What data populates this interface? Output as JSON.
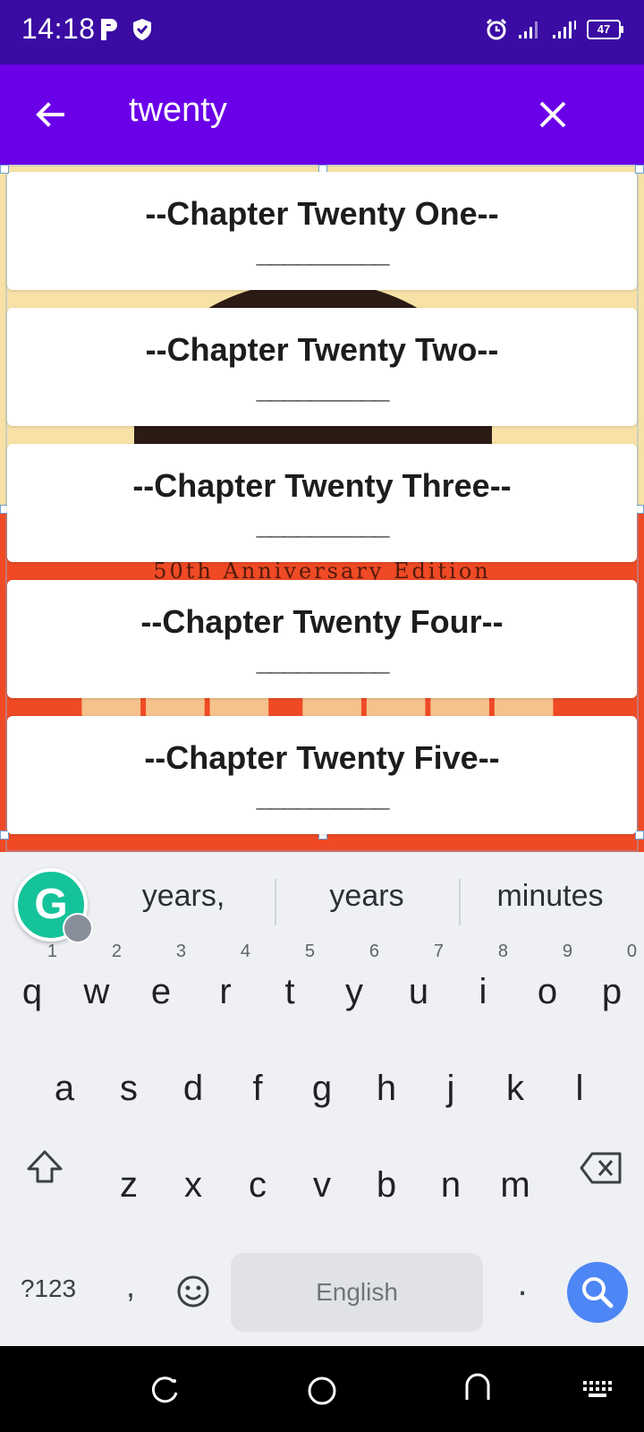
{
  "status_bar": {
    "time": "14:18",
    "battery": "47"
  },
  "app_bar": {
    "search_query": "twenty"
  },
  "results": {
    "cover_text": "50th Anniversary Edition",
    "cards": [
      {
        "title": "--Chapter Twenty One--",
        "rule": "__________"
      },
      {
        "title": "--Chapter Twenty Two--",
        "rule": "__________"
      },
      {
        "title": "--Chapter Twenty Three--",
        "rule": "__________"
      },
      {
        "title": "--Chapter Twenty Four--",
        "rule": "__________"
      },
      {
        "title": "--Chapter Twenty Five--",
        "rule": "__________"
      }
    ]
  },
  "keyboard": {
    "suggestions": [
      "years,",
      "years",
      "minutes"
    ],
    "row1": [
      "q",
      "w",
      "e",
      "r",
      "t",
      "y",
      "u",
      "i",
      "o",
      "p"
    ],
    "row1_numbers": [
      "1",
      "2",
      "3",
      "4",
      "5",
      "6",
      "7",
      "8",
      "9",
      "0"
    ],
    "row2": [
      "a",
      "s",
      "d",
      "f",
      "g",
      "h",
      "j",
      "k",
      "l"
    ],
    "row3": [
      "z",
      "x",
      "c",
      "v",
      "b",
      "n",
      "m"
    ],
    "symbols_label": "?123",
    "comma": ",",
    "period": ".",
    "space_label": "English"
  },
  "icons": {
    "back": "arrow-left-icon",
    "close": "close-icon",
    "search": "search-icon",
    "shift": "shift-icon",
    "backspace": "backspace-icon",
    "emoji": "emoji-icon"
  },
  "colors": {
    "status_bar": "#3a0ca3",
    "app_bar": "#6a00e8",
    "search_key": "#4d86f5",
    "grammarly": "#15c39a"
  }
}
